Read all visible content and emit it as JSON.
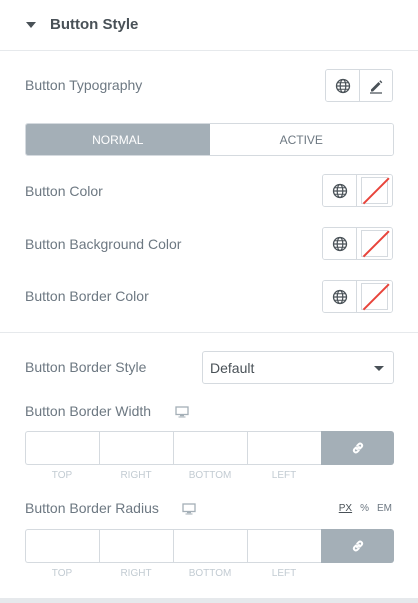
{
  "section": {
    "title": "Button Style"
  },
  "typography": {
    "label": "Button Typography",
    "globe_icon": "globe-icon",
    "edit_icon": "pencil-icon"
  },
  "state_tabs": {
    "normal": "NORMAL",
    "active": "ACTIVE",
    "selected": "NORMAL"
  },
  "colors": [
    {
      "label": "Button Color"
    },
    {
      "label": "Button Background Color"
    },
    {
      "label": "Button Border Color"
    }
  ],
  "border_style": {
    "label": "Button Border Style",
    "value": "Default"
  },
  "border_width": {
    "label": "Button Border Width",
    "device_icon": "desktop-icon",
    "sides": [
      "TOP",
      "RIGHT",
      "BOTTOM",
      "LEFT"
    ],
    "link_icon": "link-icon"
  },
  "border_radius": {
    "label": "Button Border Radius",
    "device_icon": "desktop-icon",
    "units": [
      "PX",
      "%",
      "EM"
    ],
    "selected_unit": "PX",
    "sides": [
      "TOP",
      "RIGHT",
      "BOTTOM",
      "LEFT"
    ],
    "link_icon": "link-icon"
  },
  "theme": {
    "accent": "#a4afb7",
    "border": "#d5dadf",
    "text": "#6d7882",
    "title": "#495157",
    "swatch_slash": "#e8443b"
  }
}
